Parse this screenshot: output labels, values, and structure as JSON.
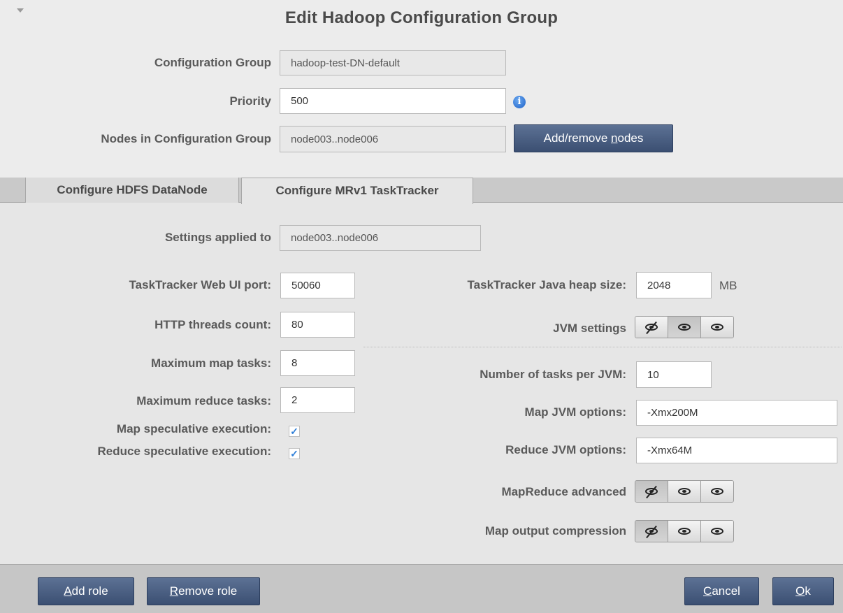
{
  "dialog": {
    "title": "Edit Hadoop Configuration Group"
  },
  "group": {
    "config_group_label": "Configuration Group",
    "config_group_value": "hadoop-test-DN-default",
    "priority_label": "Priority",
    "priority_value": "500",
    "nodes_label": "Nodes in Configuration Group",
    "nodes_value": "node003..node006",
    "add_remove_nodes": {
      "pre": "Add/remove ",
      "mnemonic": "n",
      "post": "odes"
    }
  },
  "tabs": [
    {
      "label": "Configure HDFS DataNode",
      "active": false
    },
    {
      "label": "Configure MRv1 TaskTracker",
      "active": true
    }
  ],
  "tasktracker": {
    "settings_applied_label": "Settings applied to",
    "settings_applied_value": "node003..node006",
    "web_ui_port_label": "TaskTracker Web UI port:",
    "web_ui_port_value": "50060",
    "http_threads_label": "HTTP threads count:",
    "http_threads_value": "80",
    "max_map_label": "Maximum map tasks:",
    "max_map_value": "8",
    "max_reduce_label": "Maximum reduce tasks:",
    "max_reduce_value": "2",
    "map_spec_label": "Map speculative execution:",
    "map_spec_checked": true,
    "reduce_spec_label": "Reduce speculative execution:",
    "reduce_spec_checked": true,
    "heap_label": "TaskTracker Java heap size:",
    "heap_value": "2048",
    "heap_unit": "MB",
    "jvm_settings_label": "JVM settings",
    "jvm_settings_selected": 1,
    "tasks_per_jvm_label": "Number of tasks per JVM:",
    "tasks_per_jvm_value": "10",
    "map_jvm_label": "Map JVM options:",
    "map_jvm_value": "-Xmx200M",
    "reduce_jvm_label": "Reduce JVM options:",
    "reduce_jvm_value": "-Xmx64M",
    "mr_advanced_label": "MapReduce advanced",
    "mr_advanced_selected": 0,
    "map_output_label": "Map output compression",
    "map_output_selected": 0
  },
  "footer": {
    "add_role": {
      "mnemonic": "A",
      "rest": "dd role"
    },
    "remove_role": {
      "mnemonic": "R",
      "rest": "emove role"
    },
    "cancel": {
      "mnemonic": "C",
      "rest": "ancel"
    },
    "ok": {
      "mnemonic": "O",
      "rest": "k"
    }
  },
  "colors": {
    "button": "#3b4f72",
    "background": "#e6e6e6",
    "info": "#1f62c8",
    "checkmark": "#2f7fd8"
  },
  "icons": [
    "collapse-arrow-icon",
    "info-icon",
    "eye-slash-icon",
    "eye-icon",
    "checkmark-icon"
  ]
}
